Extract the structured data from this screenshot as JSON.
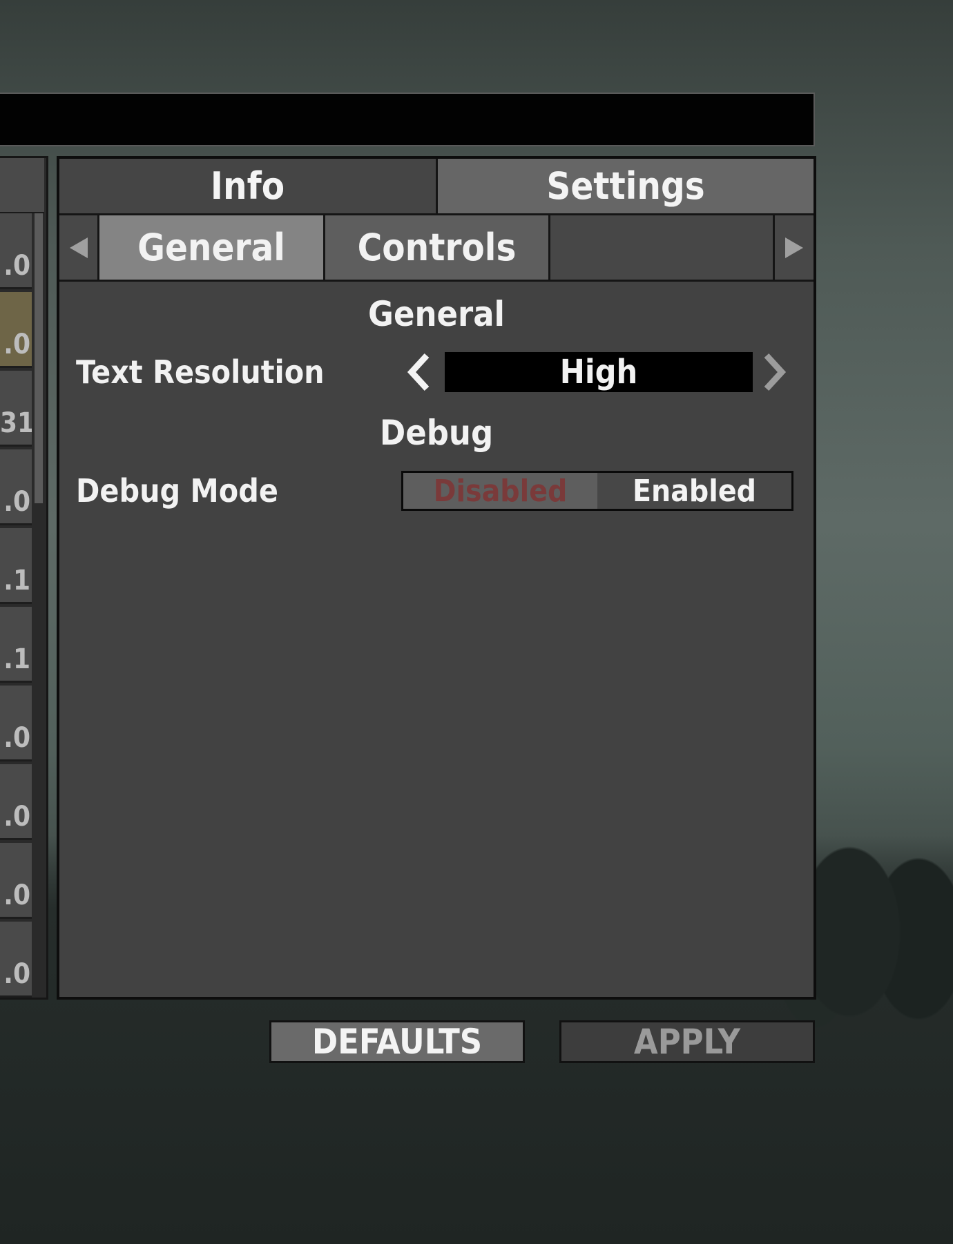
{
  "left_list": {
    "rows": [
      ".0",
      ".0",
      "31",
      ".0",
      ".1",
      ".1",
      ".0",
      ".0",
      ".0",
      ".0"
    ]
  },
  "tabs": {
    "info": "Info",
    "settings": "Settings"
  },
  "subtabs": {
    "general": "General",
    "controls": "Controls",
    "prev_icon": "triangle-left-icon",
    "next_icon": "triangle-right-icon"
  },
  "sections": {
    "general": {
      "title": "General",
      "text_resolution": {
        "label": "Text Resolution",
        "value": "High"
      }
    },
    "debug": {
      "title": "Debug",
      "debug_mode": {
        "label": "Debug Mode",
        "options": [
          "Disabled",
          "Enabled"
        ],
        "selected": "Disabled"
      }
    }
  },
  "buttons": {
    "defaults": "DEFAULTS",
    "apply": "APPLY"
  },
  "colors": {
    "panel": "#424242",
    "selected_tab": "#848484",
    "disabled_text": "#7a3a3a"
  }
}
